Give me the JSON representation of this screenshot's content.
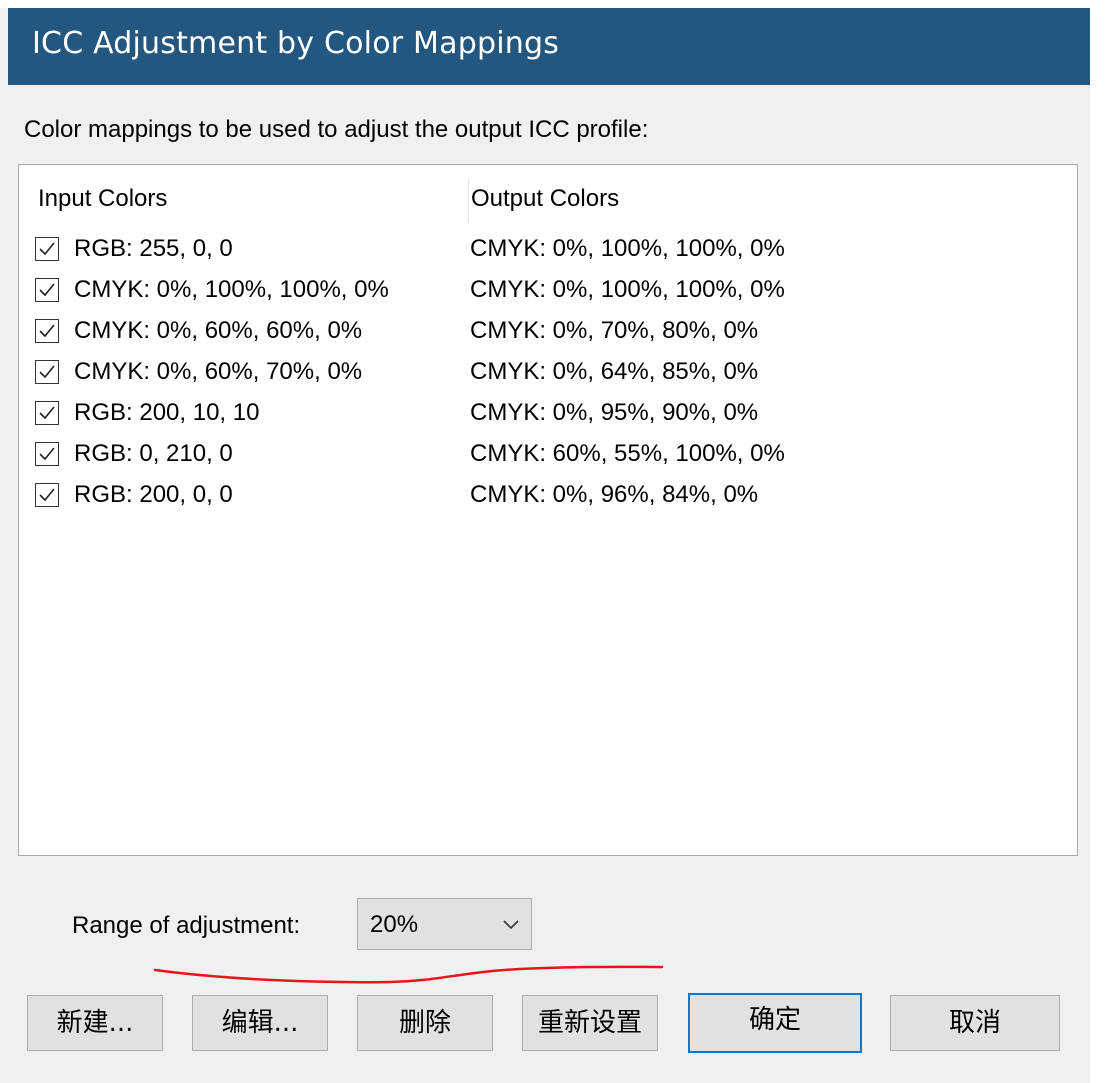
{
  "window": {
    "title": "ICC Adjustment by Color Mappings"
  },
  "prompt_text": "Color mappings to be used to adjust the output ICC profile:",
  "table": {
    "columns": [
      "Input Colors",
      "Output Colors"
    ],
    "rows": [
      {
        "checked": true,
        "input": "RGB: 255, 0, 0",
        "output": "CMYK: 0%, 100%, 100%, 0%"
      },
      {
        "checked": true,
        "input": "CMYK: 0%, 100%, 100%, 0%",
        "output": "CMYK: 0%, 100%, 100%, 0%"
      },
      {
        "checked": true,
        "input": "CMYK: 0%, 60%, 60%, 0%",
        "output": "CMYK: 0%, 70%, 80%, 0%"
      },
      {
        "checked": true,
        "input": "CMYK: 0%, 60%, 70%, 0%",
        "output": "CMYK: 0%, 64%, 85%, 0%"
      },
      {
        "checked": true,
        "input": "RGB: 200, 10, 10",
        "output": "CMYK: 0%, 95%, 90%, 0%"
      },
      {
        "checked": true,
        "input": "RGB: 0, 210, 0",
        "output": "CMYK: 60%, 55%, 100%, 0%"
      },
      {
        "checked": true,
        "input": "RGB: 200, 0, 0",
        "output": "CMYK: 0%, 96%, 84%, 0%"
      }
    ]
  },
  "range": {
    "label": "Range of adjustment:",
    "value": "20%"
  },
  "buttons": {
    "new": "新建...",
    "edit": "编辑...",
    "delete": "删除",
    "reset": "重新设置",
    "ok": "确定",
    "cancel": "取消"
  },
  "colors": {
    "titlebar": "#24577f",
    "annotation": "#e8141c",
    "focus": "#0078d7"
  }
}
